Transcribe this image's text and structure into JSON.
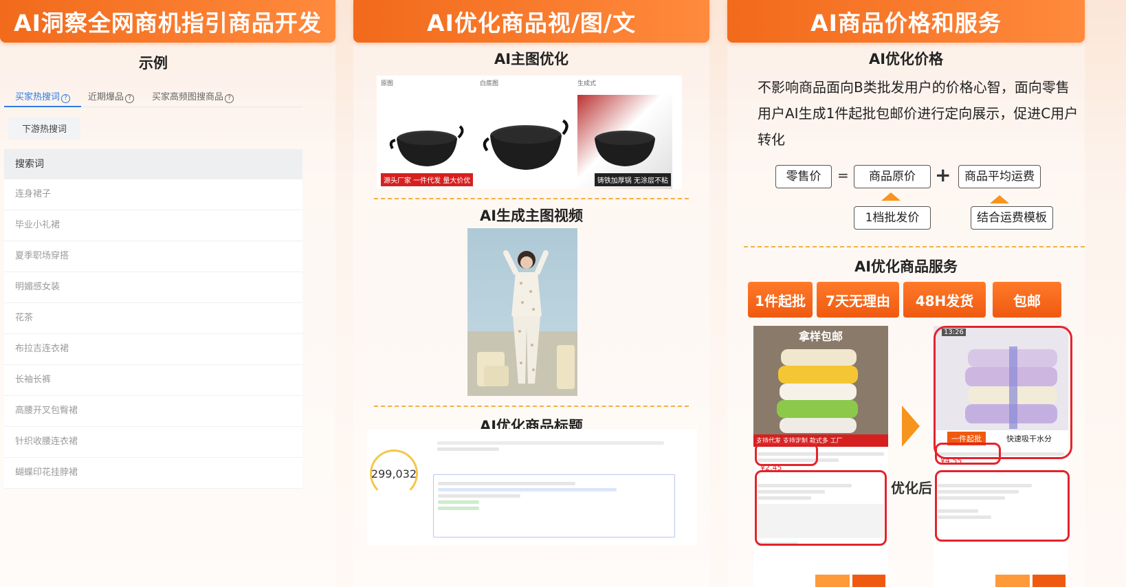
{
  "panels": {
    "discovery": {
      "header": "AI洞察全网商机指引商品开发",
      "example_title": "示例",
      "tabs": [
        "买家热搜词",
        "近期爆品",
        "买家高频图搜商品"
      ],
      "active_tab": 0,
      "chip": "下游热搜词",
      "table_header": "搜索词",
      "keywords": [
        "连身裙子",
        "毕业小礼裙",
        "夏季职场穿搭",
        "明媚感女装",
        "花茶",
        "布拉吉连衣裙",
        "长袖长裤",
        "高腰开叉包臀裙",
        "针织收腰连衣裙",
        "蝴蝶印花挂脖裙"
      ]
    },
    "media": {
      "header": "AI优化商品视/图/文",
      "main_image_title": "AI主图优化",
      "video_title": "AI生成主图视频",
      "product_title_heading": "AI优化商品标题",
      "pan_labels": [
        "原图",
        "白底图",
        "生成式"
      ],
      "pan_badges": [
        "源头厂家 一件代发 量大价优",
        "",
        "铸铁加厚锅 无涂层不粘"
      ],
      "counter_value": "299,032"
    },
    "pricing": {
      "header": "AI商品价格和服务",
      "price_title": "AI优化价格",
      "price_desc": "不影响商品面向B类批发用户的价格心智，面向零售用户AI生成1件起批包邮价进行定向展示，促进C用户转化",
      "formula": {
        "retail": "零售价",
        "equals": "=",
        "original": "商品原价",
        "plus": "+",
        "shipping": "商品平均运费",
        "tier_price": "1档批发价",
        "shipping_template": "结合运费模板"
      },
      "service_title": "AI优化商品服务",
      "services": [
        "1件起批",
        "7天无理由",
        "48H发货",
        "包邮"
      ],
      "after_label": "优化后",
      "before_phone": {
        "banner": "拿样包邮",
        "price": "¥2.45",
        "tag_line": "支持代发 支持定制 款式多 工厂"
      },
      "after_phone": {
        "time": "13:26",
        "price": "¥4.55",
        "tag_left": "一件起批",
        "tag_right": "快速吸干水分"
      }
    }
  },
  "colors": {
    "accent_orange": "#f26a1b",
    "tab_blue": "#2f7ae5",
    "ring_red": "#e3232b",
    "dash_gold": "#f0b040"
  }
}
